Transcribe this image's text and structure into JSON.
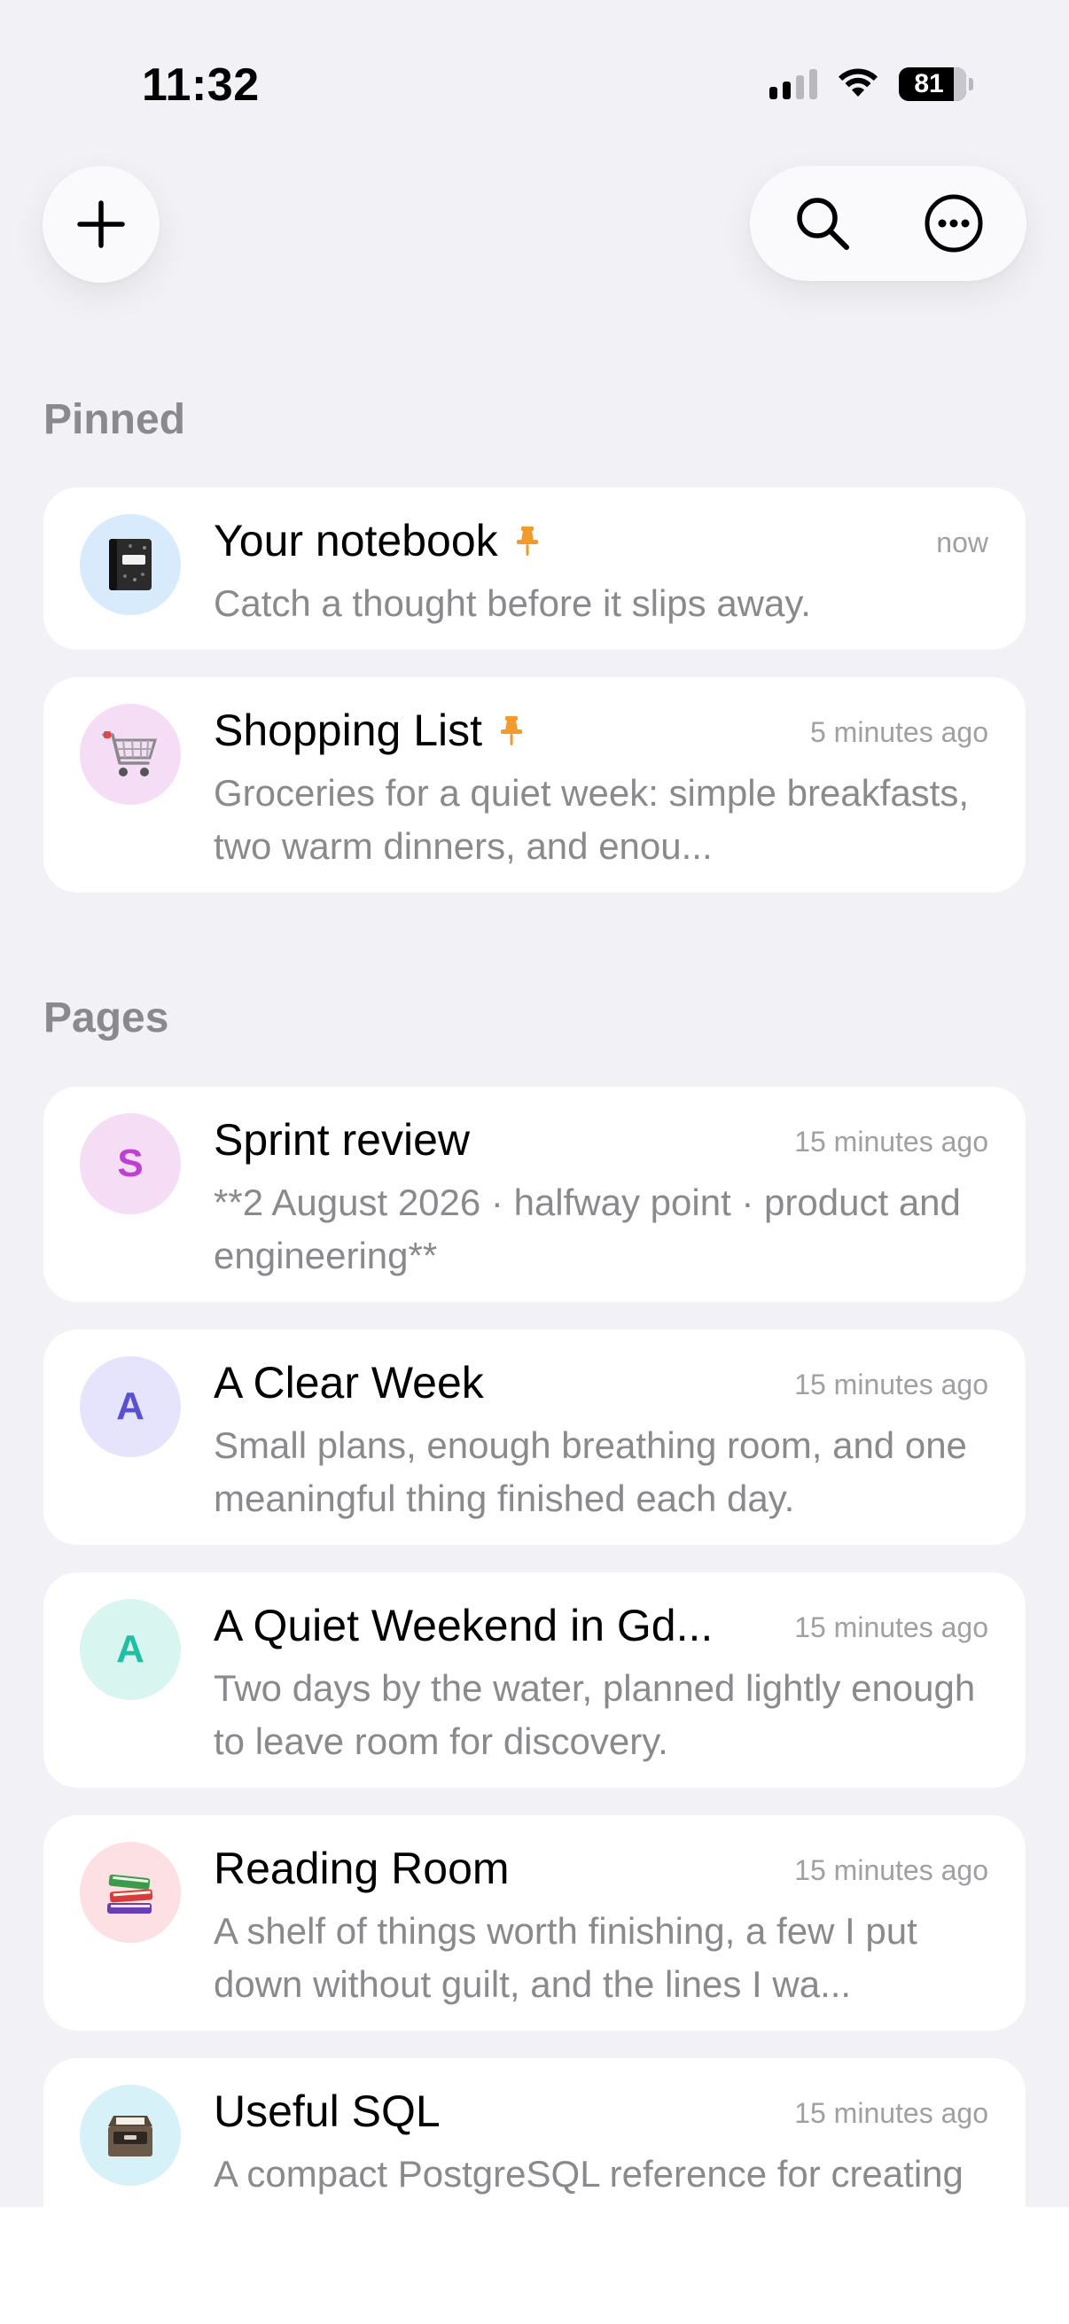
{
  "status_bar": {
    "time": "11:32",
    "battery_percent": "81",
    "signal_bars_filled": 2,
    "signal_bars_total": 4
  },
  "toolbar": {
    "add_icon": "plus-icon",
    "search_icon": "search-icon",
    "more_icon": "more-options-icon"
  },
  "sections": {
    "pinned_title": "Pinned",
    "pages_title": "Pages"
  },
  "pinned": [
    {
      "title": "Your notebook",
      "subtitle": "Catch a thought before it slips away.",
      "time": "now",
      "icon": "notebook-icon",
      "avatar_color": "#d8ebfd",
      "pinned": true
    },
    {
      "title": "Shopping List",
      "subtitle": "Groceries for a quiet week: simple breakfasts, two warm dinners, and enou...",
      "time": "5 minutes ago",
      "icon": "shopping-cart-icon",
      "avatar_color": "#f6ddf6",
      "pinned": true
    }
  ],
  "pages": [
    {
      "title": "Sprint review",
      "subtitle": "**2 August 2026 · halfway point · product and engineering**",
      "time": "15 minutes ago",
      "letter": "S",
      "avatar_color": "#f6ddf6",
      "letter_color": "#c13ed6"
    },
    {
      "title": "A Clear Week",
      "subtitle": "Small plans, enough breathing room, and one meaningful thing finished each day.",
      "time": "15 minutes ago",
      "letter": "A",
      "avatar_color": "#e6e4fc",
      "letter_color": "#5a50d6"
    },
    {
      "title": "A Quiet Weekend in Gd...",
      "subtitle": "Two days by the water, planned lightly enough to leave room for discovery.",
      "time": "15 minutes ago",
      "letter": "A",
      "avatar_color": "#d9f5f0",
      "letter_color": "#1fbfa6"
    },
    {
      "title": "Reading Room",
      "subtitle": "A shelf of things worth finishing, a few I put down without guilt, and the lines I wa...",
      "time": "15 minutes ago",
      "icon": "books-icon",
      "avatar_color": "#fde0e3"
    },
    {
      "title": "Useful SQL",
      "subtitle": "A compact PostgreSQL reference for creating tables, changing data, writing q...",
      "time": "15 minutes ago",
      "icon": "file-cabinet-icon",
      "avatar_color": "#d6f1f8"
    }
  ],
  "colors": {
    "background": "#f2f2f6",
    "card": "#ffffff",
    "pin_accent": "#f39a2c",
    "secondary_text": "#8a8a8e"
  }
}
